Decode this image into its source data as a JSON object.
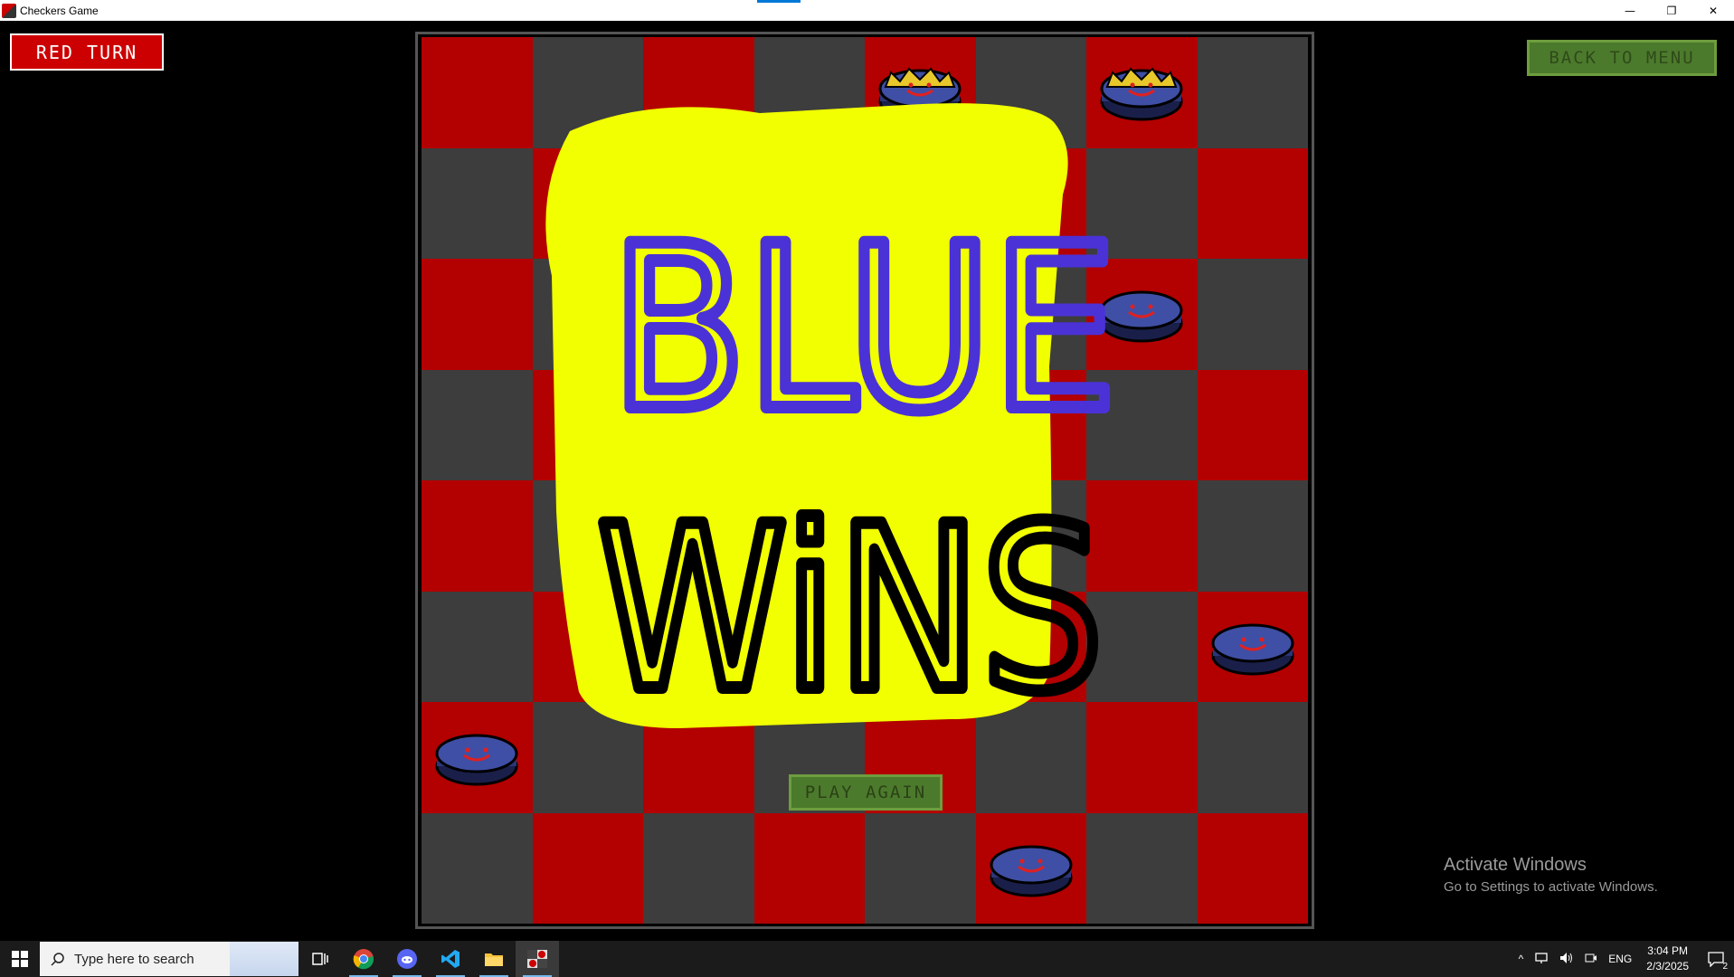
{
  "window": {
    "title": "Checkers Game",
    "minimize_glyph": "—",
    "restore_glyph": "❐",
    "close_glyph": "✕"
  },
  "game": {
    "turn_label": "RED TURN",
    "back_label": "BACK TO MENU",
    "play_again_label": "PLAY AGAIN",
    "winner_text_line1": "BLUE",
    "winner_text_line2": "WiNS",
    "board": {
      "size": 8,
      "light_color": "#b30000",
      "dark_color": "#3d3d3d",
      "pieces": [
        {
          "color": "blue",
          "king": true,
          "row": 0,
          "col": 4
        },
        {
          "color": "blue",
          "king": true,
          "row": 0,
          "col": 6
        },
        {
          "color": "blue",
          "king": false,
          "row": 2,
          "col": 6
        },
        {
          "color": "blue",
          "king": false,
          "row": 5,
          "col": 7
        },
        {
          "color": "blue",
          "king": false,
          "row": 6,
          "col": 0
        },
        {
          "color": "blue",
          "king": false,
          "row": 7,
          "col": 5
        }
      ]
    }
  },
  "watermark": {
    "title": "Activate Windows",
    "subtitle": "Go to Settings to activate Windows."
  },
  "taskbar": {
    "search_placeholder": "Type here to search",
    "apps": [
      "task-view-icon",
      "chrome-icon",
      "discord-icon",
      "vscode-icon",
      "file-explorer-icon",
      "checkers-app-icon"
    ],
    "tray_lang": "ENG",
    "time": "3:04 PM",
    "date": "2/3/2025",
    "notification_count": "2"
  },
  "colors": {
    "red_turn_bg": "#cc0000",
    "button_green": "#4c7a2c",
    "banner_yellow": "#f2ff00",
    "banner_blue_text": "#4b32d6",
    "piece_blue": "#3f4fa5"
  }
}
